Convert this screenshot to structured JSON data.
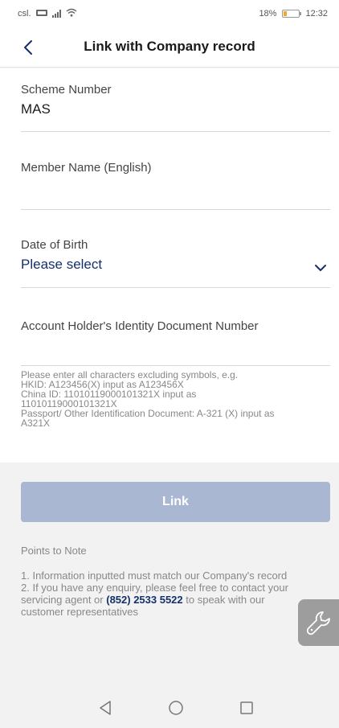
{
  "status_bar": {
    "carrier": "csl.",
    "battery": "18%",
    "time": "12:32",
    "battery_level": 0.18
  },
  "header": {
    "title": "Link with Company record"
  },
  "form": {
    "scheme_number": {
      "label": "Scheme Number",
      "value": "MAS"
    },
    "member_name": {
      "label": "Member Name (English)",
      "value": ""
    },
    "date_of_birth": {
      "label": "Date of Birth",
      "value": "Please select"
    },
    "identity_document": {
      "label": "Account Holder's Identity Document Number",
      "value": ""
    },
    "hint_lines": [
      "Please enter all characters excluding symbols, e.g.",
      "HKID: A123456(X) input as A123456X",
      "China ID: 11010119000101321X input as",
      "11010119000101321X",
      "Passport/ Other Identification Document: A-321 (X) input as",
      "A321X"
    ]
  },
  "link_button": {
    "label": "Link"
  },
  "notes": {
    "title": "Points to Note",
    "line1": "1. Information inputted must match our Company's record",
    "line2": "2. If you have any enquiry, please feel free to contact your",
    "line3_pre": "servicing agent or ",
    "phone": "(852) 2533 5522",
    "line3_post": " to speak with our",
    "line4": "customer representatives"
  },
  "colors": {
    "accent": "#14306b",
    "button_disabled": "#a9b7d3",
    "battery": "#f5a623"
  },
  "icons": [
    "back-icon",
    "chevron-down-icon",
    "wrench-icon",
    "nav-back-icon",
    "nav-home-icon",
    "nav-recents-icon"
  ]
}
